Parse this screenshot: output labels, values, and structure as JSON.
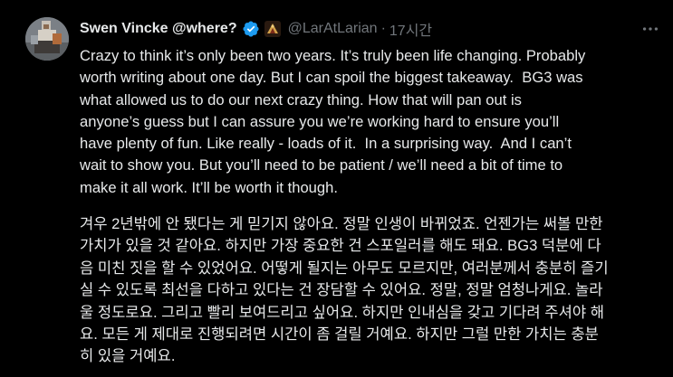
{
  "tweet": {
    "display_name": "Swen Vincke @where?",
    "handle": "@LarAtLarian",
    "separator": "·",
    "timestamp": "17시간",
    "icons": {
      "verified": "verified-checkmark-icon",
      "org_badge": "larian-affiliate-badge-icon",
      "more": "more-options-icon"
    },
    "colors": {
      "background": "#000000",
      "text": "#e7e9ea",
      "secondary_text": "#71767b",
      "verified": "#1d9bf0"
    },
    "text_en": "Crazy to think it’s only been two years. It’s truly been life changing. Probably\nworth writing about one day. But I can spoil the biggest takeaway.  BG3 was\nwhat allowed us to do our next crazy thing. How that will pan out is\nanyone’s guess but I can assure you we’re working hard to ensure you’ll\nhave plenty of fun. Like really - loads of it.  In a surprising way.  And I can’t\nwait to show you. But you’ll need to be patient / we’ll need a bit of time to\nmake it all work. It’ll be worth it though.",
    "text_ko": "겨우 2년밖에 안 됐다는 게 믿기지 않아요. 정말 인생이 바뀌었죠. 언젠가는 써볼 만한\n가치가 있을 것 같아요. 하지만 가장 중요한 건 스포일러를 해도 돼요. BG3 덕분에 다\n음 미친 짓을 할 수 있었어요. 어떻게 될지는 아무도 모르지만, 여러분께서 충분히 즐기\n실 수 있도록 최선을 다하고 있다는 건 장담할 수 있어요. 정말, 정말 엄청나게요. 놀라\n울 정도로요. 그리고 빨리 보여드리고 싶어요. 하지만 인내심을 갖고 기다려 주셔야 해\n요. 모든 게 제대로 진행되려면 시간이 좀 걸릴 거예요. 하지만 그럴 만한 가치는 충분\n히 있을 거예요."
  }
}
